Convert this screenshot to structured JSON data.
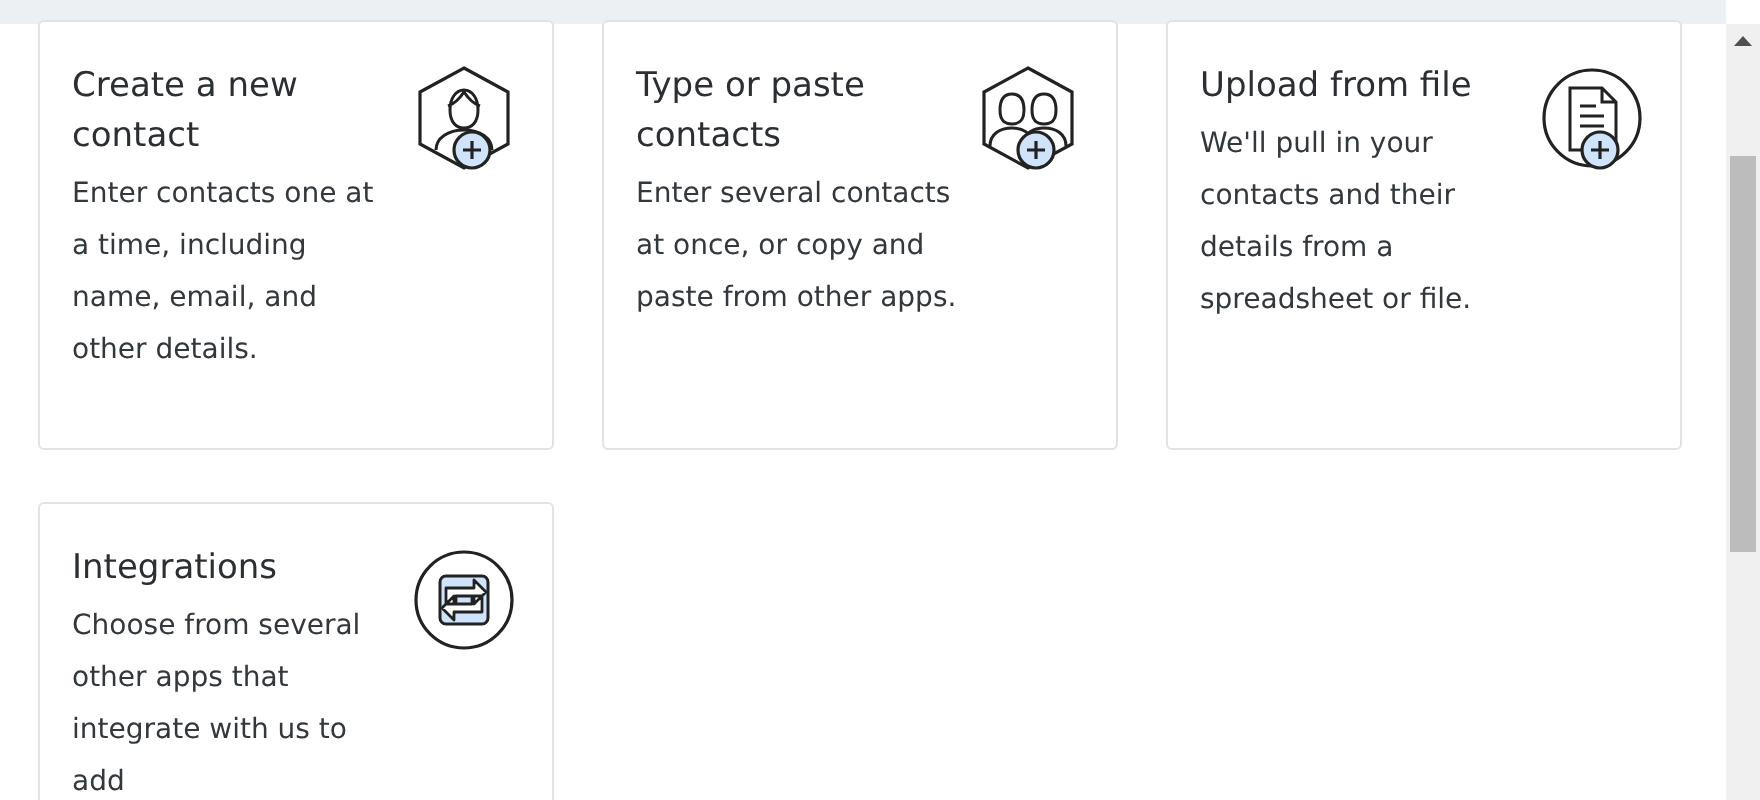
{
  "cards": [
    {
      "kind": "person",
      "title": "Create a new contact",
      "description": "Enter contacts one at a time, including name, email, and other details."
    },
    {
      "kind": "people",
      "title": "Type or paste contacts",
      "description": "Enter several contacts at once, or copy and paste from other apps."
    },
    {
      "kind": "file",
      "title": "Upload from file",
      "description": "We'll pull in your contacts and their details from a spreadsheet or file."
    },
    {
      "kind": "sync",
      "title": "Integrations",
      "description": "Choose from several other apps that integrate with us to add"
    }
  ]
}
